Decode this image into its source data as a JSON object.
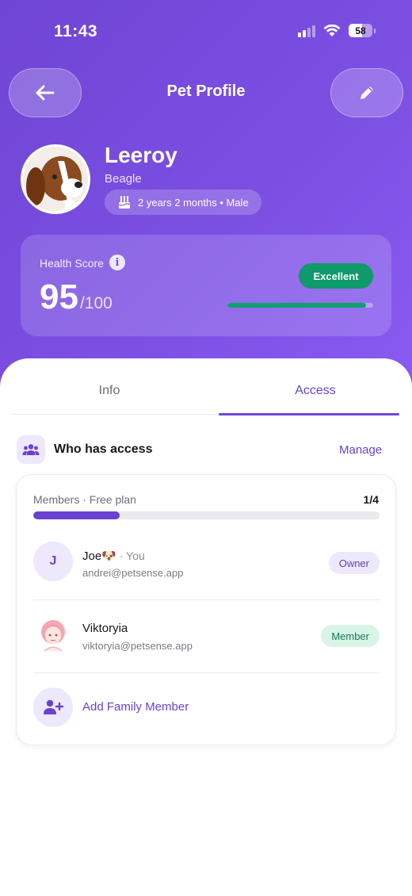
{
  "status_bar": {
    "time": "11:43",
    "battery": "58"
  },
  "header": {
    "title": "Pet Profile"
  },
  "pet": {
    "name": "Leeroy",
    "breed": "Beagle",
    "age_sex": "2 years 2 months • Male"
  },
  "health": {
    "label": "Health Score",
    "score": "95",
    "max": "/100",
    "badge": "Excellent",
    "progress_fraction": 0.95
  },
  "tabs": [
    {
      "label": "Info",
      "active": false
    },
    {
      "label": "Access",
      "active": true
    }
  ],
  "access": {
    "title": "Who has access",
    "manage_label": "Manage",
    "plan_label": "Members · Free plan",
    "plan_count": "1/4",
    "plan_fraction": 0.25,
    "members": [
      {
        "initial": "J",
        "name": "Joe🐶",
        "suffix": "· You",
        "email": "andrei@petsense.app",
        "role": "Owner"
      },
      {
        "initial": "",
        "name": "Viktoryia",
        "suffix": "",
        "email": "viktoryia@petsense.app",
        "role": "Member"
      }
    ],
    "add_label": "Add Family Member"
  },
  "colors": {
    "hero_gradient_start": "#6f45d4",
    "hero_gradient_end": "#8a5cf2",
    "accent": "#6a42cf",
    "health_green": "#0e9a6a",
    "member_badge_bg": "#d9f5e8",
    "owner_badge_bg": "#ede8fb"
  },
  "icons": {
    "back": "arrow-left-icon",
    "edit": "pencil-icon",
    "age": "birthday-cake-icon",
    "info": "info-icon",
    "access": "users-group-icon",
    "add": "user-plus-icon"
  }
}
